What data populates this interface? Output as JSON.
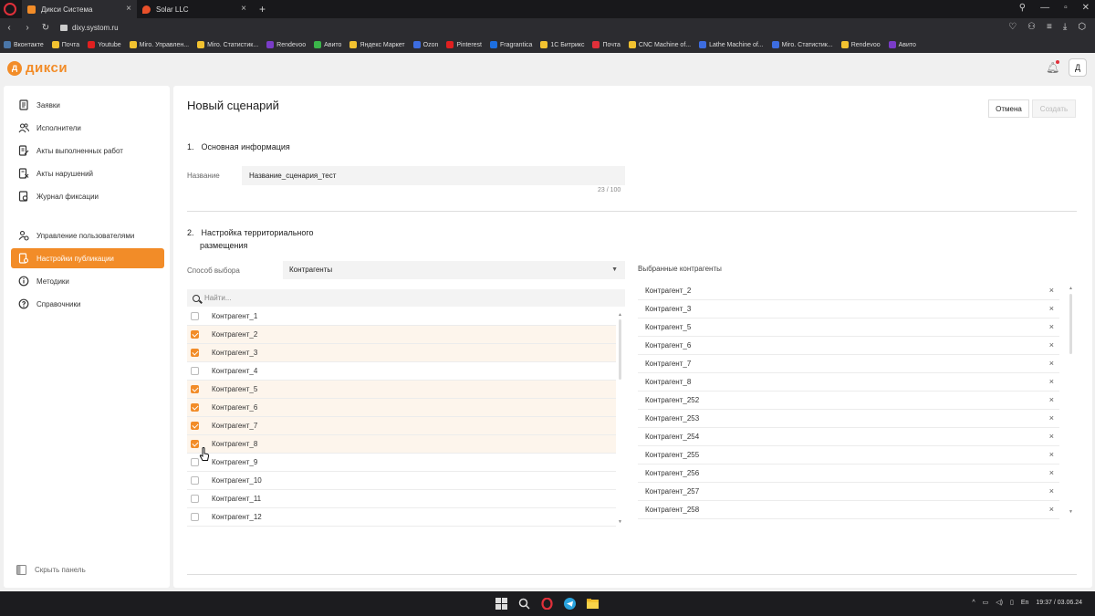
{
  "browser": {
    "tabs": [
      {
        "label": "Дикси Система",
        "active": true
      },
      {
        "label": "Solar LLC",
        "active": false
      }
    ],
    "url": "dixy.systom.ru",
    "bookmarks": [
      "Вконтакте",
      "Почта",
      "Youtube",
      "Miro. Управлен...",
      "Miro. Статистик...",
      "Rendevoo",
      "Авито",
      "Яндекс Маркет",
      "Ozon",
      "Pinterest",
      "Fragrantica",
      "1С Битрикс",
      "Почта",
      "CNC Machine of...",
      "Lathe Machine of...",
      "Miro. Статистик...",
      "Rendevoo",
      "Авито"
    ]
  },
  "app": {
    "logo_text": "дикси",
    "avatar_label": "Д"
  },
  "sidebar": {
    "items": [
      {
        "label": "Заявки"
      },
      {
        "label": "Исполнители"
      },
      {
        "label": "Акты выполненных работ"
      },
      {
        "label": "Акты нарушений"
      },
      {
        "label": "Журнал фиксации"
      },
      {
        "label": "Управление пользователями"
      },
      {
        "label": "Настройки публикации"
      },
      {
        "label": "Методики"
      },
      {
        "label": "Справочники"
      }
    ],
    "collapse_label": "Скрыть панель"
  },
  "main": {
    "title": "Новый сценарий",
    "cancel_label": "Отмена",
    "save_label": "Создать",
    "section1": {
      "num": "1.",
      "title": "Основная информация"
    },
    "name_label": "Название",
    "name_value": "Название_сценария_тест",
    "name_counter": "23 / 100",
    "section2": {
      "num": "2.",
      "title_line1": "Настройка территориального",
      "title_line2": "размещения"
    },
    "method_label": "Способ выбора",
    "method_value": "Контрагенты",
    "search_placeholder": "Найти...",
    "contractors": [
      {
        "label": "Контрагент_1",
        "checked": false
      },
      {
        "label": "Контрагент_2",
        "checked": true
      },
      {
        "label": "Контрагент_3",
        "checked": true
      },
      {
        "label": "Контрагент_4",
        "checked": false
      },
      {
        "label": "Контрагент_5",
        "checked": true
      },
      {
        "label": "Контрагент_6",
        "checked": true
      },
      {
        "label": "Контрагент_7",
        "checked": true
      },
      {
        "label": "Контрагент_8",
        "checked": true
      },
      {
        "label": "Контрагент_9",
        "checked": false
      },
      {
        "label": "Контрагент_10",
        "checked": false
      },
      {
        "label": "Контрагент_11",
        "checked": false
      },
      {
        "label": "Контрагент_12",
        "checked": false
      }
    ],
    "selected_title": "Выбранные контрагенты",
    "selected": [
      "Контрагент_2",
      "Контрагент_3",
      "Контрагент_5",
      "Контрагент_6",
      "Контрагент_7",
      "Контрагент_8",
      "Контрагент_252",
      "Контрагент_253",
      "Контрагент_254",
      "Контрагент_255",
      "Контрагент_256",
      "Контрагент_257",
      "Контрагент_258"
    ]
  },
  "taskbar": {
    "lang": "En",
    "time": "19:37",
    "date": "03.06.24"
  },
  "colors": {
    "accent": "#f28c28"
  }
}
